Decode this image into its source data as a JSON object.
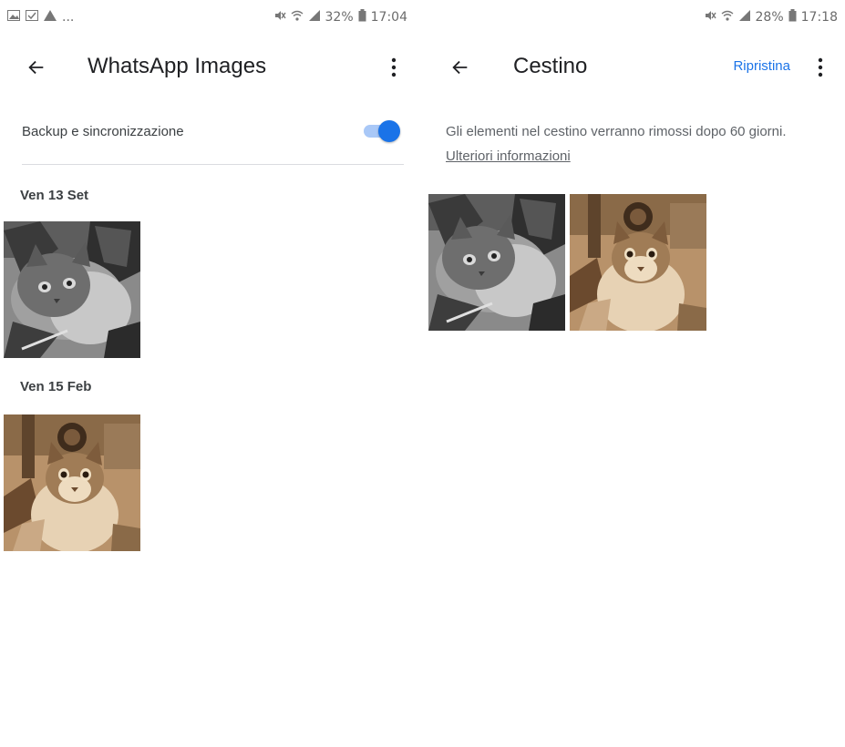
{
  "colors": {
    "accent": "#1a73e8",
    "toggle_track": "#a9c8f7",
    "text_primary": "#202124",
    "text_secondary": "#5f6368"
  },
  "left_screen": {
    "status_bar": {
      "left_icons": [
        "gallery-icon",
        "check-icon",
        "warning-icon"
      ],
      "left_ellipsis": "...",
      "right_icons": [
        "mute-icon",
        "wifi-icon",
        "signal-icon"
      ],
      "battery": "32%",
      "time": "17:04"
    },
    "app_bar": {
      "back_icon": "arrow-left-icon",
      "title": "WhatsApp Images",
      "menu_icon": "more-vert-icon"
    },
    "backup": {
      "label": "Backup e sincronizzazione",
      "enabled": true
    },
    "sections": [
      {
        "date": "Ven 13 Set",
        "photo": "grey tabby cat photo"
      },
      {
        "date": "Ven 15 Feb",
        "photo": "sepia cat photo"
      }
    ]
  },
  "right_screen": {
    "status_bar": {
      "right_icons": [
        "mute-icon",
        "wifi-icon",
        "signal-icon"
      ],
      "battery": "28%",
      "time": "17:18"
    },
    "app_bar": {
      "back_icon": "arrow-left-icon",
      "title": "Cestino",
      "restore_label": "Ripristina",
      "menu_icon": "more-vert-icon"
    },
    "info": {
      "text": "Gli elementi nel cestino verranno rimossi dopo 60 giorni.",
      "link": "Ulteriori informazioni"
    },
    "photos": [
      "grey tabby cat photo",
      "sepia cat photo"
    ]
  }
}
